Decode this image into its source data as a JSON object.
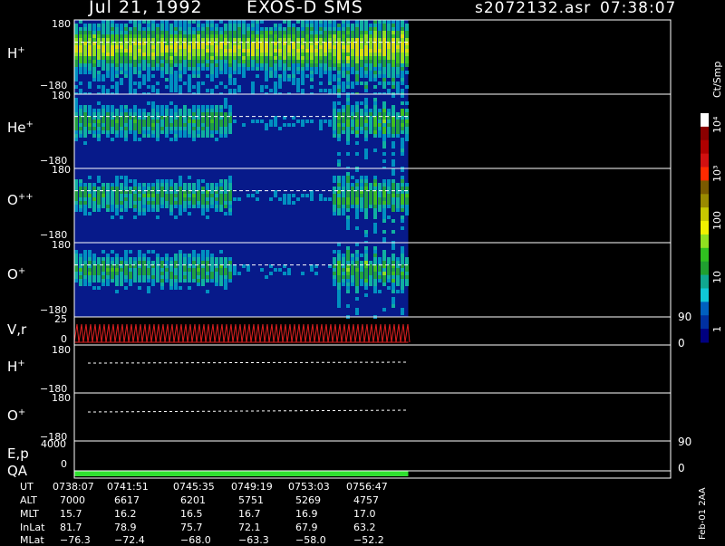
{
  "header": {
    "date": "Jul 21, 1992",
    "instrument": "EXOS-D SMS",
    "filename": "s2072132.asr",
    "time": "07:38:07"
  },
  "panels": [
    {
      "id": "h",
      "label": "H",
      "charge": "+",
      "top_tick": "180",
      "bottom_tick": "−180"
    },
    {
      "id": "he",
      "label": "He",
      "charge": "+",
      "top_tick": "180",
      "bottom_tick": "−180"
    },
    {
      "id": "opp",
      "label": "O",
      "charge": "++",
      "top_tick": "180",
      "bottom_tick": "−180"
    },
    {
      "id": "op",
      "label": "O",
      "charge": "+",
      "top_tick": "180",
      "bottom_tick": "−180"
    },
    {
      "id": "vr",
      "label": "V,r",
      "top_tick": "25",
      "bottom_tick": "0",
      "right_top": "90",
      "right_bottom": "0"
    },
    {
      "id": "h2",
      "label": "H",
      "charge": "+",
      "top_tick": "180",
      "bottom_tick": "−180"
    },
    {
      "id": "o2",
      "label": "O",
      "charge": "+",
      "top_tick": "180",
      "bottom_tick": "−180"
    },
    {
      "id": "ep",
      "label": "E,p",
      "top_tick": "4000",
      "bottom_tick": "0",
      "right_top": "90",
      "right_bottom": "0"
    },
    {
      "id": "qa",
      "label": "QA"
    }
  ],
  "colorbar": {
    "unit": "Ct/Smp",
    "labels": [
      "10⁴",
      "10³",
      "100",
      "10",
      "1"
    ],
    "colors": [
      "#ffffff",
      "#8b0000",
      "#b00000",
      "#d21010",
      "#ff2a00",
      "#7a5a00",
      "#9a8a00",
      "#c8c800",
      "#f0f000",
      "#90e020",
      "#30c020",
      "#20a030",
      "#10a890",
      "#10c8d8",
      "#0060c0",
      "#0030a0",
      "#000080"
    ]
  },
  "stamp": "Feb-01 2AA",
  "chart_data": {
    "type": "heatmap",
    "title": "Jul 21, 1992 EXOS-D SMS",
    "x_label": "UT",
    "y_range": [
      -180,
      180
    ],
    "data_coverage_fraction": 0.56,
    "colorbar_unit": "Ct/Smp",
    "colorbar_range": [
      1,
      10000
    ],
    "series": [
      {
        "name": "H+",
        "intensity_level": "high"
      },
      {
        "name": "He+",
        "intensity_level": "medium"
      },
      {
        "name": "O++",
        "intensity_level": "medium"
      },
      {
        "name": "O+",
        "intensity_level": "medium"
      }
    ],
    "table": {
      "row_labels": [
        "UT",
        "ALT",
        "MLT",
        "InLat",
        "MLat"
      ],
      "columns": [
        [
          "0738:07",
          "7000",
          "15.7",
          "81.7",
          "−76.3"
        ],
        [
          "0741:51",
          "6617",
          "16.2",
          "78.9",
          "−72.4"
        ],
        [
          "0745:35",
          "6201",
          "16.5",
          "75.7",
          "−68.0"
        ],
        [
          "0749:19",
          "5751",
          "16.7",
          "72.1",
          "−63.3"
        ],
        [
          "0753:03",
          "5269",
          "16.9",
          "67.9",
          "−58.0"
        ],
        [
          "0756:47",
          "4757",
          "17.0",
          "63.2",
          "−52.2"
        ]
      ]
    }
  }
}
